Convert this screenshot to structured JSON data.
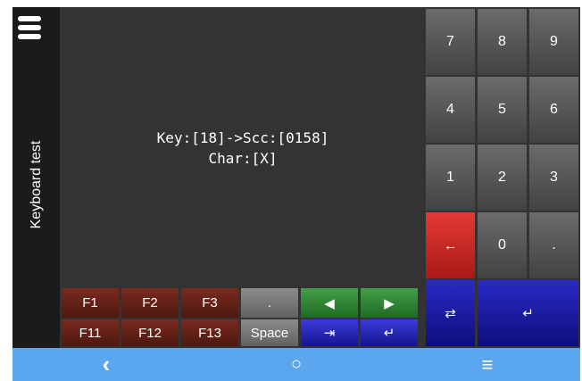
{
  "sidebar": {
    "title": "Keyboard test"
  },
  "display": {
    "line1": "Key:[18]->Scc:[0158]",
    "line2": "Char:[X]"
  },
  "function_keys": {
    "f1": "F1",
    "f2": "F2",
    "f3": "F3",
    "f11": "F11",
    "f12": "F12",
    "f13": "F13",
    "dot": ".",
    "space": "Space",
    "left_arrow": "◀",
    "right_arrow": "▶",
    "tab": "⇥",
    "enter": "↵"
  },
  "numpad": {
    "k7": "7",
    "k8": "8",
    "k9": "9",
    "k4": "4",
    "k5": "5",
    "k6": "6",
    "k1": "1",
    "k2": "2",
    "k3": "3",
    "backspace": "←",
    "k0": "0",
    "dot": ".",
    "backtab": "⇄",
    "enter": "↵"
  },
  "navbar": {
    "back": "‹",
    "home": "○",
    "menu": "≡"
  },
  "colors": {
    "fkey": "#6b2418",
    "green": "#2e7d32",
    "blue": "#2626b8",
    "red": "#d32f2f",
    "nav": "#5aa6ef",
    "bg": "#333333",
    "sidebar": "#1b1b1b"
  }
}
